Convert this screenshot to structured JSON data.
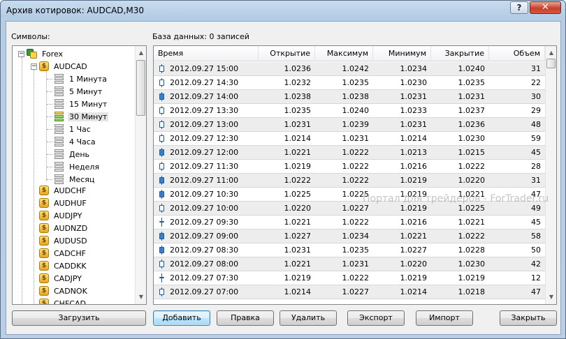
{
  "window": {
    "title": "Архив котировок: AUDCAD,M30",
    "help_label": "?",
    "close_label": "✕"
  },
  "labels": {
    "symbols": "Символы:",
    "database": "База данных: 0 записей"
  },
  "tree": {
    "root": "Forex",
    "expanded_symbol": "AUDCAD",
    "timeframes": [
      "1 Минута",
      "5 Минут",
      "15 Минут",
      "30 Минут",
      "1 Час",
      "4 Часа",
      "День",
      "Неделя",
      "Месяц"
    ],
    "selected_timeframe": "30 Минут",
    "symbols": [
      "AUDCHF",
      "AUDHUF",
      "AUDJPY",
      "AUDNZD",
      "AUDUSD",
      "CADCHF",
      "CADDKK",
      "CADJPY",
      "CADNOK",
      "CHFCAD"
    ],
    "expander_minus": "−",
    "coin_glyph": "$"
  },
  "grid": {
    "columns": [
      "Время",
      "Открытие",
      "Максимум",
      "Минимум",
      "Закрытие",
      "Объем"
    ],
    "rows": [
      {
        "time": "2012.09.27 15:00",
        "open": "1.0236",
        "high": "1.0242",
        "low": "1.0234",
        "close": "1.0240",
        "volume": "31"
      },
      {
        "time": "2012.09.27 14:30",
        "open": "1.0232",
        "high": "1.0235",
        "low": "1.0230",
        "close": "1.0235",
        "volume": "22"
      },
      {
        "time": "2012.09.27 14:00",
        "open": "1.0238",
        "high": "1.0238",
        "low": "1.0231",
        "close": "1.0231",
        "volume": "30"
      },
      {
        "time": "2012.09.27 13:30",
        "open": "1.0235",
        "high": "1.0240",
        "low": "1.0233",
        "close": "1.0237",
        "volume": "29"
      },
      {
        "time": "2012.09.27 13:00",
        "open": "1.0231",
        "high": "1.0239",
        "low": "1.0231",
        "close": "1.0236",
        "volume": "48"
      },
      {
        "time": "2012.09.27 12:30",
        "open": "1.0214",
        "high": "1.0231",
        "low": "1.0214",
        "close": "1.0230",
        "volume": "59"
      },
      {
        "time": "2012.09.27 12:00",
        "open": "1.0221",
        "high": "1.0222",
        "low": "1.0213",
        "close": "1.0215",
        "volume": "45"
      },
      {
        "time": "2012.09.27 11:30",
        "open": "1.0219",
        "high": "1.0222",
        "low": "1.0216",
        "close": "1.0222",
        "volume": "28"
      },
      {
        "time": "2012.09.27 11:00",
        "open": "1.0222",
        "high": "1.0222",
        "low": "1.0219",
        "close": "1.0220",
        "volume": "31"
      },
      {
        "time": "2012.09.27 10:30",
        "open": "1.0225",
        "high": "1.0225",
        "low": "1.0219",
        "close": "1.0221",
        "volume": "47"
      },
      {
        "time": "2012.09.27 10:00",
        "open": "1.0220",
        "high": "1.0227",
        "low": "1.0219",
        "close": "1.0225",
        "volume": "49"
      },
      {
        "time": "2012.09.27 09:30",
        "open": "1.0221",
        "high": "1.0222",
        "low": "1.0216",
        "close": "1.0221",
        "volume": "45"
      },
      {
        "time": "2012.09.27 09:00",
        "open": "1.0227",
        "high": "1.0234",
        "low": "1.0221",
        "close": "1.0222",
        "volume": "58"
      },
      {
        "time": "2012.09.27 08:30",
        "open": "1.0231",
        "high": "1.0235",
        "low": "1.0227",
        "close": "1.0228",
        "volume": "50"
      },
      {
        "time": "2012.09.27 08:00",
        "open": "1.0221",
        "high": "1.0231",
        "low": "1.0220",
        "close": "1.0230",
        "volume": "42"
      },
      {
        "time": "2012.09.27 07:30",
        "open": "1.0219",
        "high": "1.0222",
        "low": "1.0219",
        "close": "1.0219",
        "volume": "12"
      },
      {
        "time": "2012.09.27 07:00",
        "open": "1.0214",
        "high": "1.0227",
        "low": "1.0214",
        "close": "1.0218",
        "volume": "47"
      }
    ]
  },
  "watermark": "Портал для трейдеров - ForTrader.ru",
  "buttons": {
    "load": "Загрузить",
    "add": "Добавить",
    "edit": "Правка",
    "delete": "Удалить",
    "export": "Экспорт",
    "import": "Импорт",
    "close": "Закрыть"
  },
  "scroll_arrows": {
    "up": "▲",
    "down": "▼"
  }
}
